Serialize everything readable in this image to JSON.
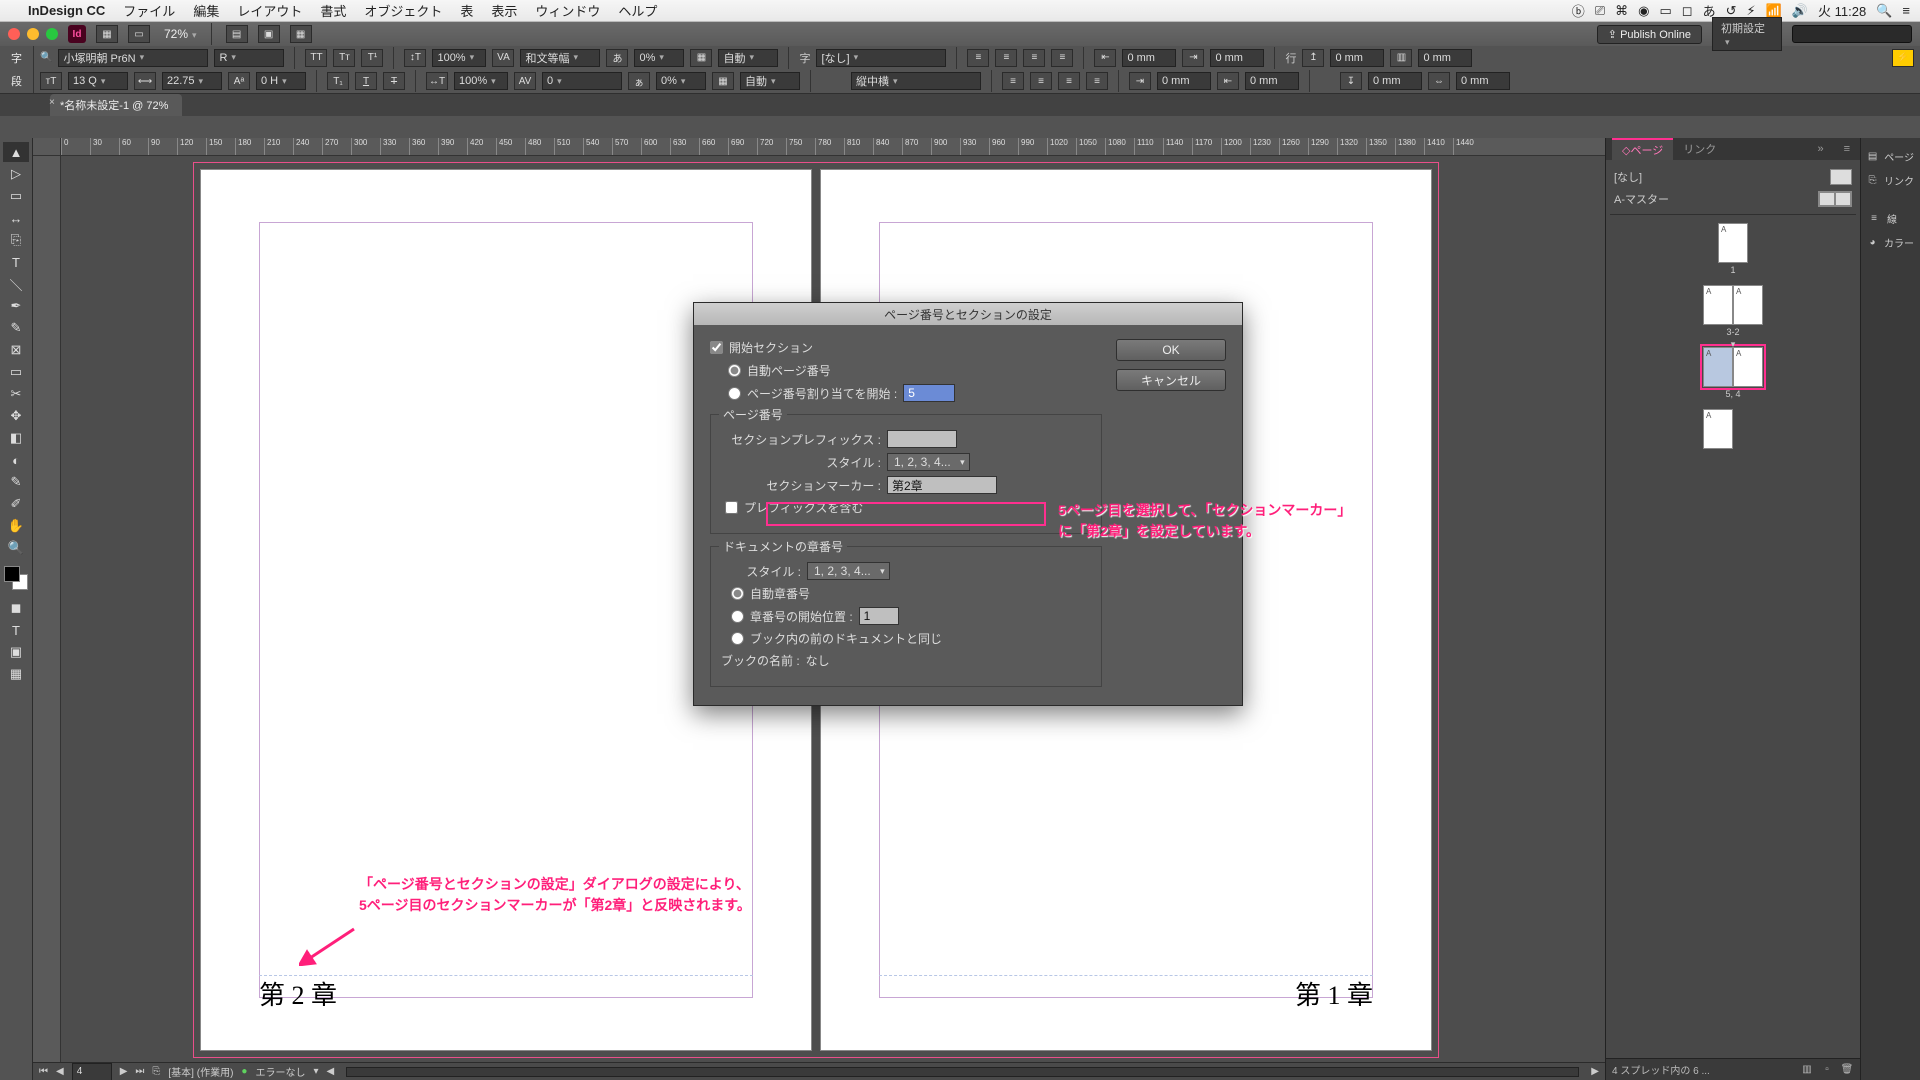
{
  "menubar": {
    "app": "InDesign CC",
    "items": [
      "ファイル",
      "編集",
      "レイアウト",
      "書式",
      "オブジェクト",
      "表",
      "表示",
      "ウィンドウ",
      "ヘルプ"
    ],
    "clock": "火 11:28"
  },
  "window": {
    "zoom": "72%",
    "publish": "Publish Online",
    "preset": "初期設定"
  },
  "control": {
    "char_label": "字",
    "para_label": "段",
    "font": "小塚明朝 Pr6N",
    "weight": "R",
    "size": "13 Q",
    "leading": "22.75",
    "baseline": "0 H",
    "scale_h": "100%",
    "scale_v": "100%",
    "tracking": "0",
    "kerning": "和文等幅",
    "pct2": "0%",
    "lang": "自動",
    "auto2": "自動",
    "jikumi_label": "字",
    "jikumi_value": "[なし]",
    "tategaki": "縦中横",
    "mm0": "0 mm",
    "gyou_label": "行"
  },
  "doc_tab": "*名称未設定-1 @ 72%",
  "ruler_ticks": [
    "0",
    "30",
    "60",
    "90",
    "120",
    "150",
    "180",
    "210",
    "240",
    "270",
    "300",
    "330",
    "360",
    "390",
    "420",
    "450",
    "480",
    "510",
    "540",
    "570",
    "600",
    "630",
    "660",
    "690",
    "720",
    "750",
    "780",
    "810",
    "840",
    "870",
    "900",
    "930",
    "960",
    "990",
    "1020",
    "1050",
    "1080",
    "1110",
    "1140",
    "1170",
    "1200",
    "1230",
    "1260",
    "1290",
    "1320",
    "1350",
    "1380",
    "1410",
    "1440"
  ],
  "pages": {
    "left_marker": "第 2 章",
    "right_marker": "第 1 章"
  },
  "annotations": {
    "dialog_note_l1": "5ページ目を選択して、「セクションマーカー」",
    "dialog_note_l2": "に「第2章」を設定しています。",
    "canvas_note_l1": "「ページ番号とセクションの設定」ダイアログの設定により、",
    "canvas_note_l2": "5ページ目のセクションマーカーが「第2章」と反映されます。"
  },
  "dialog": {
    "title": "ページ番号とセクションの設定",
    "start_section": "開始セクション",
    "auto_page": "自動ページ番号",
    "assign_start": "ページ番号割り当てを開始 :",
    "assign_start_val": "5",
    "grp_pagenum": "ページ番号",
    "prefix": "セクションプレフィックス :",
    "style": "スタイル :",
    "style_val": "1, 2, 3, 4...",
    "marker": "セクションマーカー :",
    "marker_val": "第2章",
    "include_prefix": "プレフィックスを含む",
    "grp_chapter": "ドキュメントの章番号",
    "chap_style": "スタイル :",
    "chap_style_val": "1, 2, 3, 4...",
    "auto_chap": "自動章番号",
    "chap_start": "章番号の開始位置 :",
    "chap_start_val": "1",
    "same_as_prev": "ブック内の前のドキュメントと同じ",
    "book_name_lab": "ブックの名前 :",
    "book_name_val": "なし",
    "ok": "OK",
    "cancel": "キャンセル"
  },
  "pages_panel": {
    "tab_pages": "ページ",
    "tab_links": "リンク",
    "none": "[なし]",
    "a_master": "A-マスター",
    "p1": "1",
    "p3_2": "3-2",
    "p5_4": "5, 4",
    "footer": "4 スプレッド内の 6 ..."
  },
  "iconstrip": {
    "pages": "ページ",
    "links": "リンク",
    "stroke": "線",
    "color": "カラー"
  },
  "status": {
    "page_nav": "4",
    "style": "[基本] (作業用)",
    "errors": "エラーなし"
  }
}
